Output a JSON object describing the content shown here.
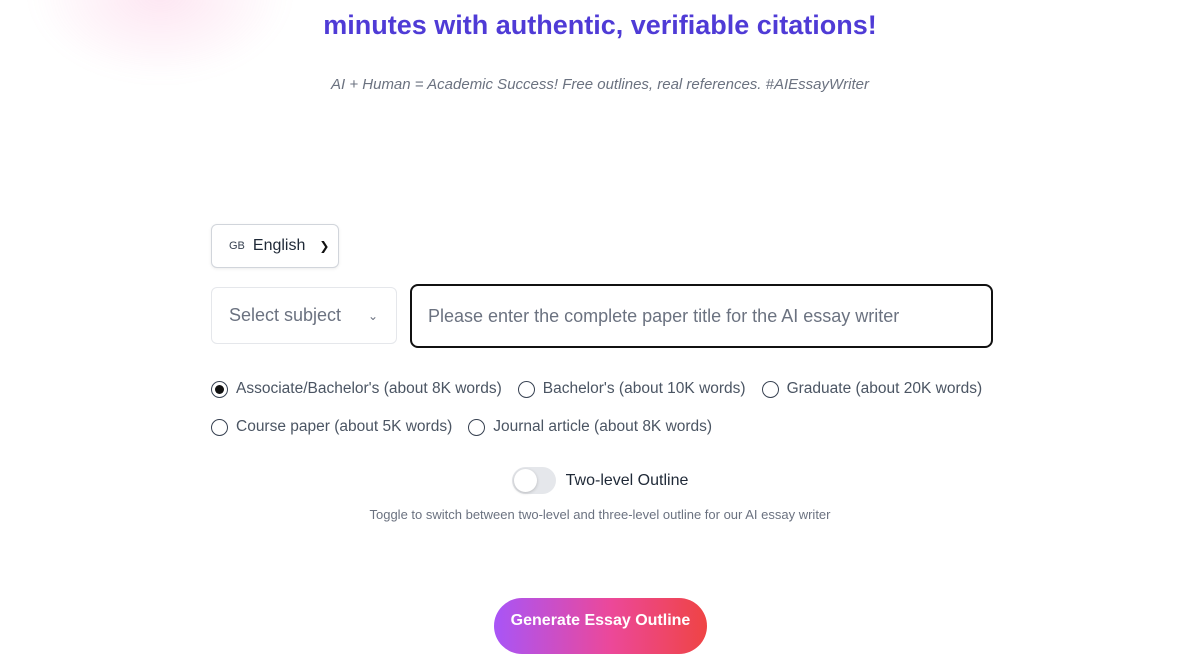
{
  "hero": {
    "title_line2": "minutes with authentic, verifiable citations!",
    "subtitle": "AI + Human = Academic Success! Free outlines, real references. #AIEssayWriter"
  },
  "language": {
    "flag": "GB",
    "label": "English",
    "icon": "chevron-down-icon"
  },
  "subject": {
    "placeholder": "Select subject",
    "icon": "chevron-down-icon"
  },
  "title_input": {
    "value": "",
    "placeholder": "Please enter the complete paper title for the AI essay writer"
  },
  "paper_types": [
    {
      "label": "Associate/Bachelor's (about 8K words)",
      "selected": true
    },
    {
      "label": "Bachelor's (about 10K words)",
      "selected": false
    },
    {
      "label": "Graduate (about 20K words)",
      "selected": false
    },
    {
      "label": "Course paper (about 5K words)",
      "selected": false
    },
    {
      "label": "Journal article (about 8K words)",
      "selected": false
    }
  ],
  "outline_toggle": {
    "label": "Two-level Outline",
    "on": false,
    "hint": "Toggle to switch between two-level and three-level outline for our AI essay writer"
  },
  "generate_button": {
    "label": "Generate Essay Outline"
  },
  "colors": {
    "heading": "#4f3bd6",
    "button_gradient": [
      "#a855f7",
      "#ec4899",
      "#ef4444"
    ]
  }
}
